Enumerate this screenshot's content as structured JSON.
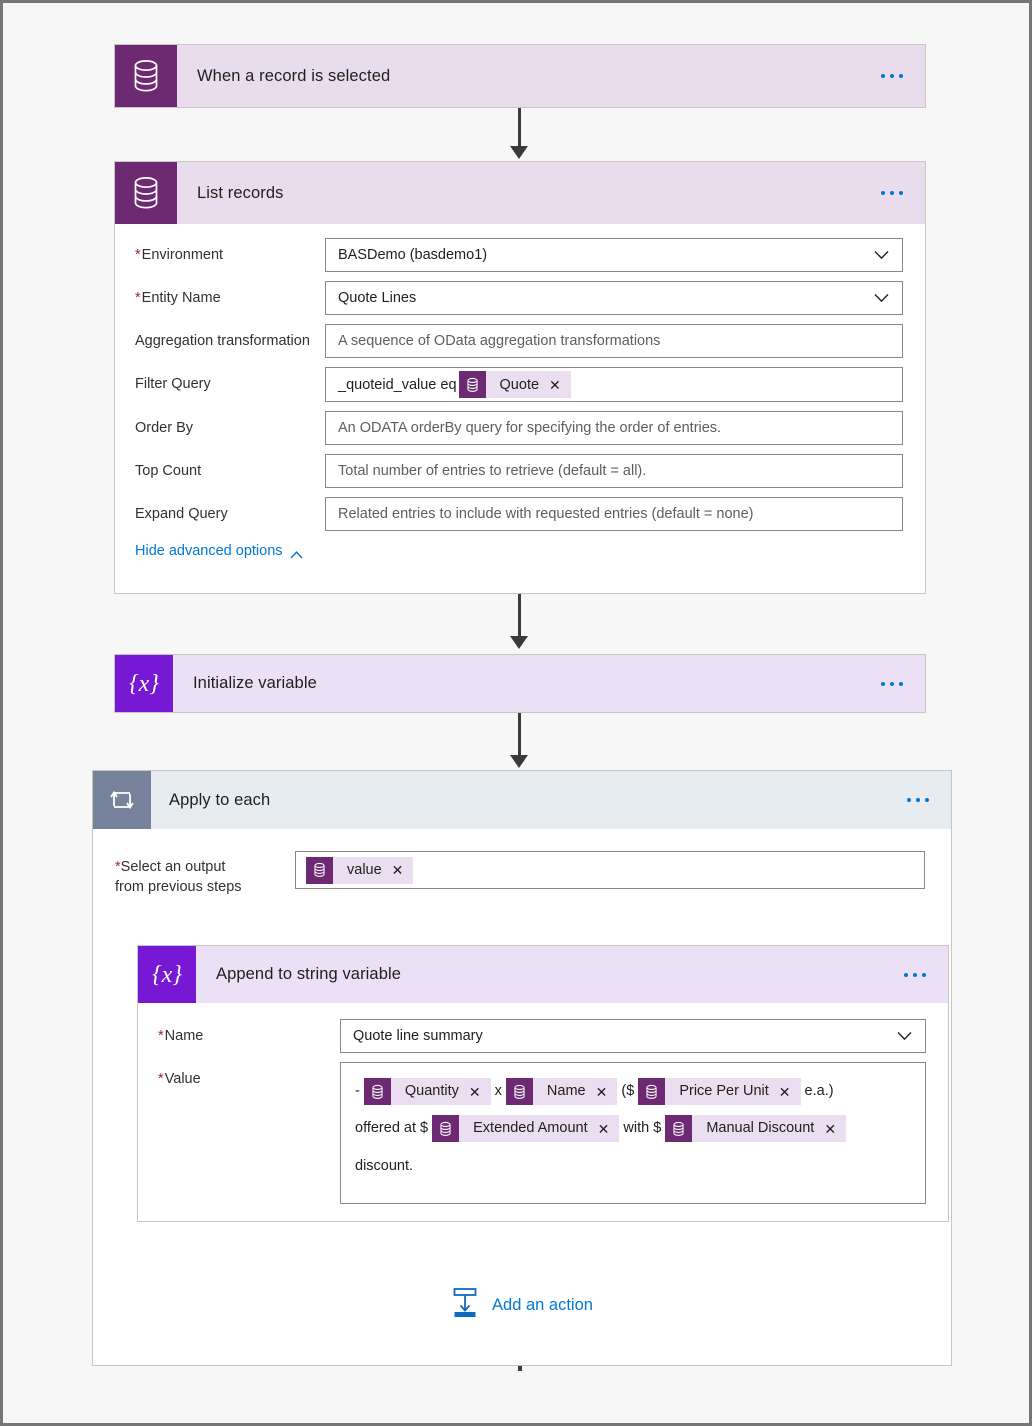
{
  "flow": {
    "trigger": {
      "title": "When a record is selected",
      "icon": "dataverse-icon",
      "menu": "more-options"
    },
    "list_records": {
      "title": "List records",
      "icon": "dataverse-icon",
      "fields": [
        {
          "label": "Environment",
          "required": true,
          "value": "BASDemo (basdemo1)",
          "placeholder": "",
          "type": "dropdown"
        },
        {
          "label": "Entity Name",
          "required": true,
          "value": "Quote Lines",
          "placeholder": "",
          "type": "dropdown"
        },
        {
          "label": "Aggregation transformation",
          "required": false,
          "value": "",
          "placeholder": "A sequence of OData aggregation transformations",
          "type": "text"
        },
        {
          "label": "Filter Query",
          "required": false,
          "value": "_quoteid_value eq",
          "token": "Quote",
          "placeholder": "",
          "type": "token-text"
        },
        {
          "label": "Order By",
          "required": false,
          "value": "",
          "placeholder": "An ODATA orderBy query for specifying the order of entries.",
          "type": "text"
        },
        {
          "label": "Top Count",
          "required": false,
          "value": "",
          "placeholder": "Total number of entries to retrieve (default = all).",
          "type": "text"
        },
        {
          "label": "Expand Query",
          "required": false,
          "value": "",
          "placeholder": "Related entries to include with requested entries (default = none)",
          "type": "text"
        }
      ],
      "advanced_toggle": "Hide advanced options"
    },
    "initialize_variable": {
      "title": "Initialize variable",
      "icon": "variable-icon"
    },
    "apply_to_each": {
      "title": "Apply to each",
      "icon": "loop-icon",
      "output_label_line1": "Select an output",
      "output_label_line2": "from previous steps",
      "output_token": "value",
      "append": {
        "title": "Append to string variable",
        "icon": "variable-icon",
        "name_label": "Name",
        "name_value": "Quote line summary",
        "value_label": "Value",
        "value_parts": [
          {
            "kind": "text",
            "text": "-"
          },
          {
            "kind": "token",
            "text": "Quantity"
          },
          {
            "kind": "text",
            "text": "x"
          },
          {
            "kind": "token",
            "text": "Name"
          },
          {
            "kind": "text",
            "text": "($"
          },
          {
            "kind": "token",
            "text": "Price Per Unit"
          },
          {
            "kind": "text",
            "text": "e.a.)"
          },
          {
            "kind": "break"
          },
          {
            "kind": "text",
            "text": "offered at $"
          },
          {
            "kind": "token",
            "text": "Extended Amount"
          },
          {
            "kind": "text",
            "text": "with $"
          },
          {
            "kind": "token",
            "text": "Manual Discount"
          },
          {
            "kind": "break"
          },
          {
            "kind": "text",
            "text": "discount."
          }
        ]
      },
      "add_action_label": "Add an action"
    }
  },
  "colors": {
    "dataverse_purple": "#6d2a73",
    "variable_purple": "#7719d4",
    "loop_grey": "#77839a",
    "header_lilac": "#e8daef",
    "accent_blue": "#0078d4",
    "required_red": "#a4262c",
    "token_bg": "#eadef0"
  },
  "icons": {
    "dataverse": "database-icon",
    "variable": "variable-braces-icon",
    "loop": "loop-icon",
    "more": "more-horizontal-icon",
    "chevron_down": "chevron-down-icon",
    "chevron_up": "chevron-up-icon",
    "add_action": "insert-action-icon",
    "remove_token": "close-icon"
  }
}
